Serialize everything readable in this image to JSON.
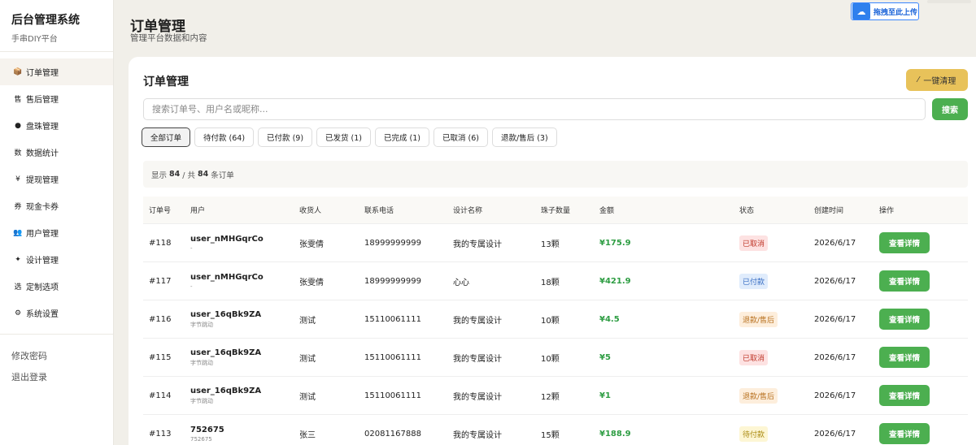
{
  "brand": {
    "title": "后台管理系统",
    "subtitle": "手串DIY平台"
  },
  "sidebar": {
    "items": [
      {
        "icon": "📦",
        "label": "订单管理",
        "active": true
      },
      {
        "icon": "售",
        "label": "售后管理"
      },
      {
        "icon": "●",
        "label": "盘珠管理"
      },
      {
        "icon": "数",
        "label": "数据统计"
      },
      {
        "icon": "¥",
        "label": "提现管理"
      },
      {
        "icon": "券",
        "label": "现金卡券"
      },
      {
        "icon": "👥",
        "label": "用户管理"
      },
      {
        "icon": "✦",
        "label": "设计管理"
      },
      {
        "icon": "选",
        "label": "定制选项"
      },
      {
        "icon": "⚙",
        "label": "系统设置"
      }
    ],
    "footer": {
      "change_password": "修改密码",
      "logout": "退出登录"
    }
  },
  "header": {
    "title": "订单管理",
    "subtitle": "管理平台数据和内容"
  },
  "upload_badge": {
    "label": "拖拽至此上传"
  },
  "card": {
    "title": "订单管理",
    "clear_button": "一键清理",
    "search": {
      "placeholder": "搜索订单号、用户名或昵称...",
      "button": "搜索"
    },
    "tabs": [
      {
        "label": "全部订单",
        "active": true
      },
      {
        "label": "待付款 (64)"
      },
      {
        "label": "已付款 (9)"
      },
      {
        "label": "已发货 (1)"
      },
      {
        "label": "已完成 (1)"
      },
      {
        "label": "已取消 (6)"
      },
      {
        "label": "退款/售后 (3)"
      }
    ],
    "summary": {
      "prefix": "显示",
      "shown": "84",
      "sep": "/ 共",
      "total": "84",
      "suffix": "条订单"
    }
  },
  "table": {
    "columns": [
      "订单号",
      "用户",
      "收货人",
      "联系电话",
      "设计名称",
      "珠子数量",
      "金额",
      "状态",
      "创建时间",
      "操作"
    ],
    "rows": [
      {
        "id": "#118",
        "user": "user_nMHGqrCo",
        "user_sub": "-",
        "receiver": "张雯倩",
        "phone": "18999999999",
        "design": "我的专属设计",
        "beads": "13颗",
        "amount": "¥175.9",
        "status": "已取消",
        "status_type": "cancel",
        "date": "2026/6/17",
        "action": "查看详情"
      },
      {
        "id": "#117",
        "user": "user_nMHGqrCo",
        "user_sub": "-",
        "receiver": "张雯倩",
        "phone": "18999999999",
        "design": "心心",
        "beads": "18颗",
        "amount": "¥421.9",
        "status": "已付款",
        "status_type": "paid",
        "date": "2026/6/17",
        "action": "查看详情"
      },
      {
        "id": "#116",
        "user": "user_16qBk9ZA",
        "user_sub": "字节跳动",
        "receiver": "测试",
        "phone": "15110061111",
        "design": "我的专属设计",
        "beads": "10颗",
        "amount": "¥4.5",
        "status": "退款/售后",
        "status_type": "refund",
        "date": "2026/6/17",
        "action": "查看详情"
      },
      {
        "id": "#115",
        "user": "user_16qBk9ZA",
        "user_sub": "字节跳动",
        "receiver": "测试",
        "phone": "15110061111",
        "design": "我的专属设计",
        "beads": "10颗",
        "amount": "¥5",
        "status": "已取消",
        "status_type": "cancel",
        "date": "2026/6/17",
        "action": "查看详情"
      },
      {
        "id": "#114",
        "user": "user_16qBk9ZA",
        "user_sub": "字节跳动",
        "receiver": "测试",
        "phone": "15110061111",
        "design": "我的专属设计",
        "beads": "12颗",
        "amount": "¥1",
        "status": "退款/售后",
        "status_type": "refund",
        "date": "2026/6/17",
        "action": "查看详情"
      },
      {
        "id": "#113",
        "user": "752675",
        "user_sub": "752675",
        "receiver": "张三",
        "phone": "02081167888",
        "design": "我的专属设计",
        "beads": "15颗",
        "amount": "¥188.9",
        "status": "待付款",
        "status_type": "pending",
        "date": "2026/6/17",
        "action": "查看详情"
      }
    ]
  }
}
